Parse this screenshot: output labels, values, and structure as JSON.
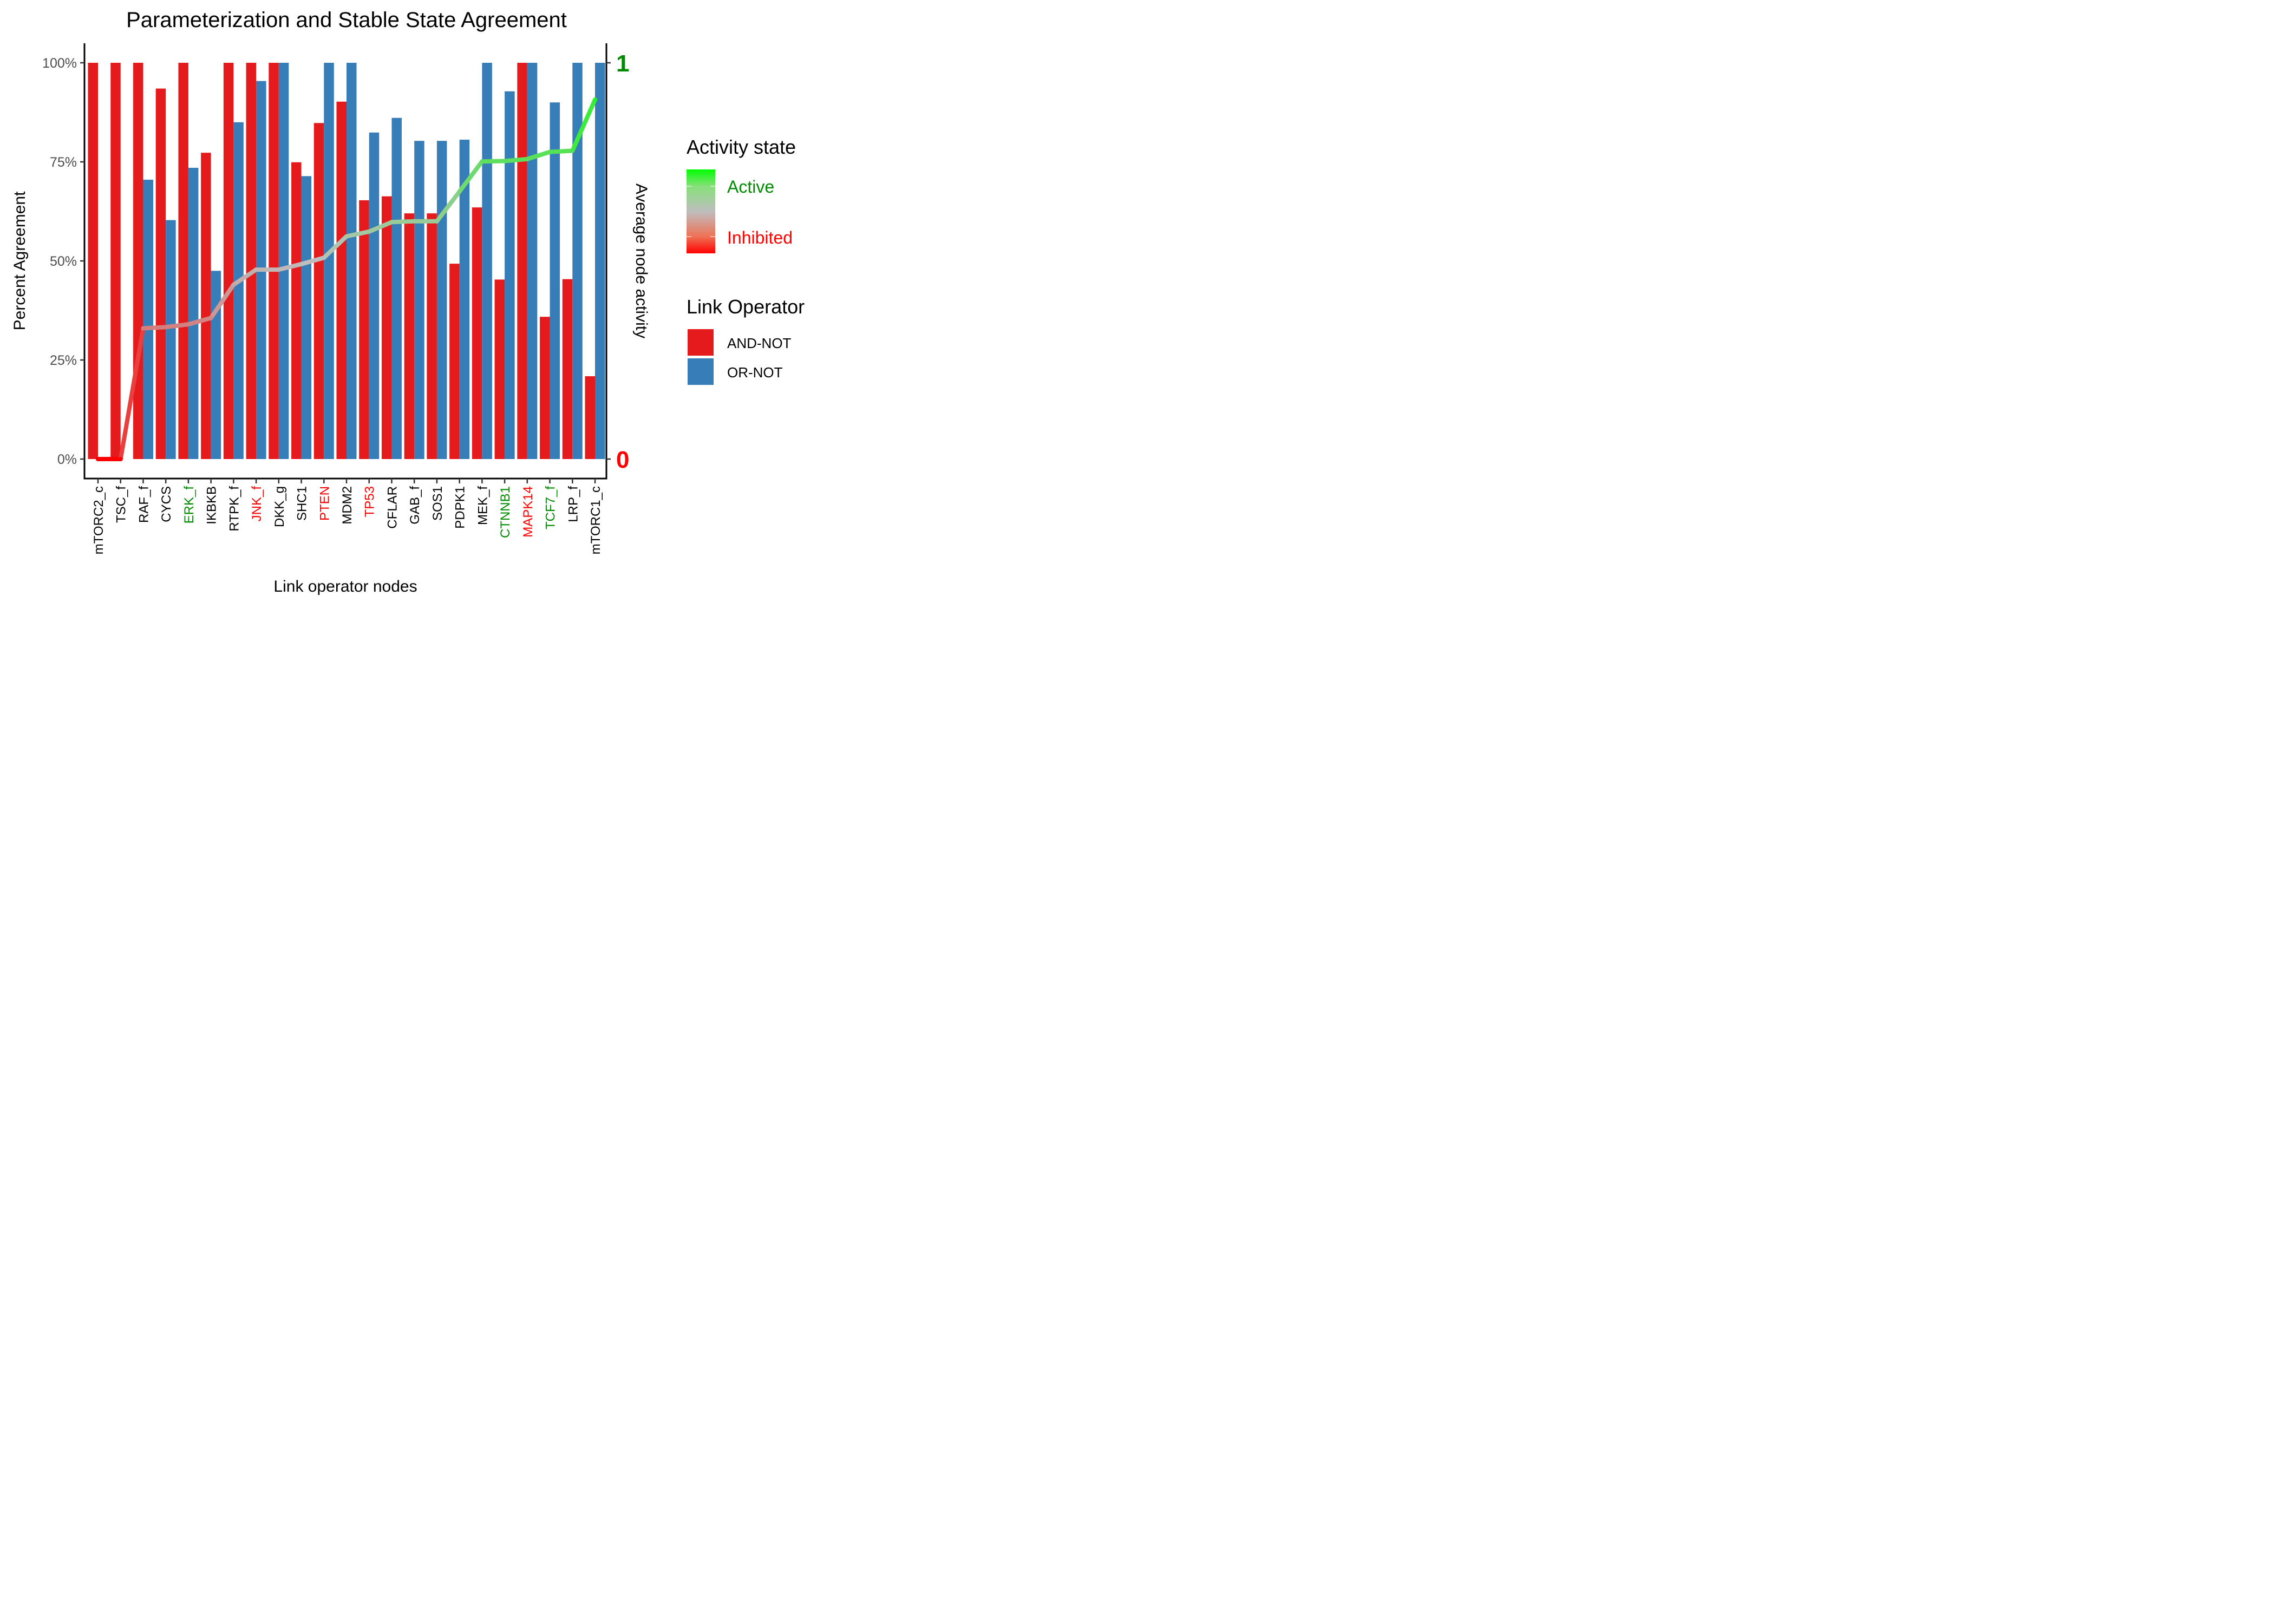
{
  "chart_data": {
    "type": "bar",
    "title": "Parameterization and Stable State Agreement",
    "xlabel": "Link operator nodes",
    "ylabel": "Percent Agreement",
    "y2label": "Average node activity",
    "ylim": [
      0,
      100
    ],
    "y2lim": [
      0,
      1
    ],
    "yticks": [
      "0%",
      "25%",
      "50%",
      "75%",
      "100%"
    ],
    "y2ticks": [
      {
        "value": 0,
        "label": "0",
        "color": "#ff0000"
      },
      {
        "value": 1,
        "label": "1",
        "color": "#008b00"
      }
    ],
    "grid": false,
    "categories": [
      "mTORC2_c",
      "TSC_f",
      "RAF_f",
      "CYCS",
      "ERK_f",
      "IKBKB",
      "RTPK_f",
      "JNK_f",
      "DKK_g",
      "SHC1",
      "PTEN",
      "MDM2",
      "TP53",
      "CFLAR",
      "GAB_f",
      "SOS1",
      "PDPK1",
      "MEK_f",
      "CTNNB1",
      "MAPK14",
      "TCF7_f",
      "LRP_f",
      "mTORC1_c"
    ],
    "category_label_colors": [
      "#000000",
      "#000000",
      "#000000",
      "#000000",
      "#008b00",
      "#000000",
      "#000000",
      "#ff0000",
      "#000000",
      "#000000",
      "#ff0000",
      "#000000",
      "#ff0000",
      "#000000",
      "#000000",
      "#000000",
      "#000000",
      "#000000",
      "#008b00",
      "#ff0000",
      "#008b00",
      "#000000",
      "#000000"
    ],
    "series": [
      {
        "name": "AND-NOT",
        "color": "#e41a1c",
        "values": [
          100,
          100,
          100,
          93.5,
          100,
          77.3,
          100,
          100,
          100,
          74.9,
          84.8,
          90.2,
          65.3,
          66.3,
          62.0,
          62.0,
          49.3,
          63.5,
          45.3,
          100,
          35.9,
          45.4,
          20.9
        ]
      },
      {
        "name": "OR-NOT",
        "color": "#377eb8",
        "values": [
          null,
          null,
          70.5,
          60.3,
          73.5,
          47.5,
          85.0,
          95.4,
          100,
          71.4,
          100,
          100,
          82.4,
          86.1,
          80.3,
          80.3,
          80.6,
          100,
          92.8,
          100,
          90.0,
          100,
          100
        ]
      }
    ],
    "line": {
      "name": "Average node activity",
      "values": [
        0,
        0,
        0.33,
        0.333,
        0.34,
        0.356,
        0.44,
        0.478,
        0.478,
        0.492,
        0.508,
        0.562,
        0.574,
        0.598,
        0.6,
        0.6,
        0.675,
        0.751,
        0.752,
        0.757,
        0.775,
        0.778,
        0.907
      ],
      "color_low": "#ff0000",
      "color_mid": "#bebebe",
      "color_high": "#00ff00"
    },
    "legend": {
      "placement": "right",
      "activity_title": "Activity state",
      "activity_labels": [
        {
          "label": "Active",
          "color": "#008b00"
        },
        {
          "label": "Inhibited",
          "color": "#ff0000"
        }
      ],
      "operator_title": "Link Operator",
      "operator_items": [
        {
          "label": "AND-NOT",
          "color": "#e41a1c"
        },
        {
          "label": "OR-NOT",
          "color": "#377eb8"
        }
      ]
    }
  }
}
